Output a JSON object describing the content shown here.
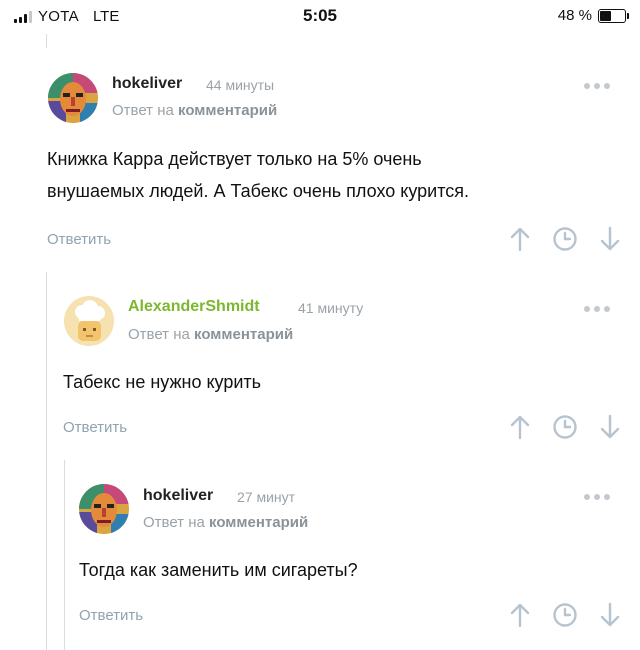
{
  "status_bar": {
    "carrier": "YOTA",
    "network": "LTE",
    "time": "5:05",
    "battery": "48 %",
    "battery_level": 0.48
  },
  "colors": {
    "accent_green": "#7cb82f",
    "muted_text": "#9aa2a8",
    "reply_link": "#8fa3b1",
    "icon": "#b7c4cf"
  },
  "comments": [
    {
      "author": "hokeliver",
      "time": "44 минуты",
      "reply_prefix": "Ответ на",
      "reply_link": "комментарий",
      "text_lines": [
        "Книжка Карра действует только на 5% очень",
        "внушаемых людей. А Табекс очень плохо курится."
      ],
      "reply_label": "Ответить",
      "avatar_icon": "abstract-face-avatar"
    },
    {
      "author": "AlexanderShmidt",
      "time": "41 минуту",
      "reply_prefix": "Ответ на",
      "reply_link": "комментарий",
      "text_lines": [
        "Табекс не нужно курить"
      ],
      "reply_label": "Ответить",
      "avatar_icon": "chef-avatar"
    },
    {
      "author": "hokeliver",
      "time": "27 минут",
      "reply_prefix": "Ответ на",
      "reply_link": "комментарий",
      "text_lines": [
        "Тогда как заменить им сигареты?"
      ],
      "reply_label": "Ответить",
      "avatar_icon": "abstract-face-avatar"
    }
  ],
  "action_icons": [
    "arrow-up-icon",
    "clock-icon",
    "arrow-down-icon"
  ],
  "menu_icon": "more-dots-icon"
}
